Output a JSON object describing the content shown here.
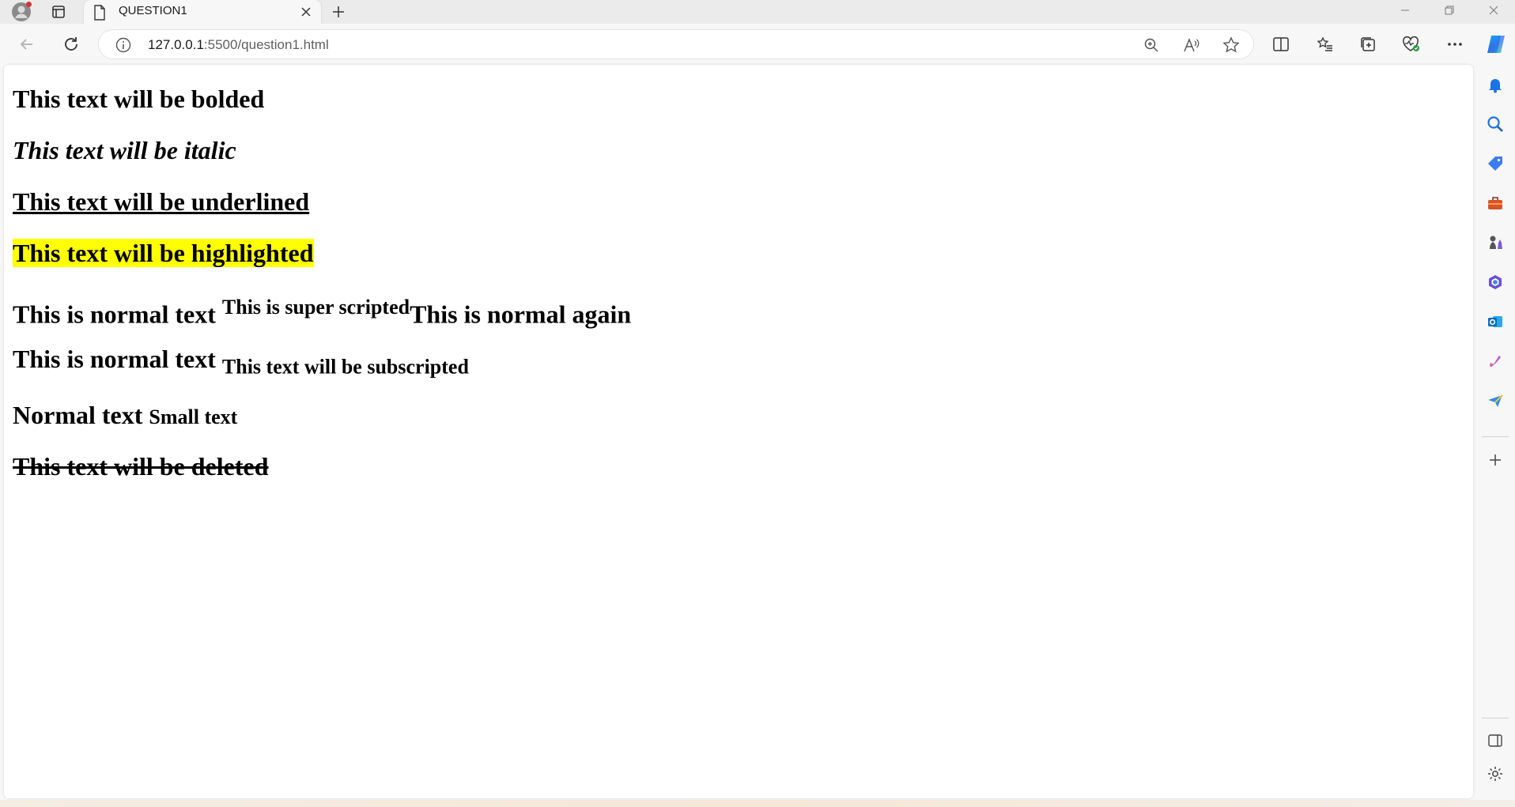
{
  "browser": {
    "tab_title": "QUESTION1",
    "url_host": "127.0.0.1",
    "url_path": ":5500/question1.html"
  },
  "page": {
    "bold_text": "This text will be bolded",
    "italic_text": "This text will be italic",
    "underline_text": "This text will be underlined",
    "highlight_text": "This text will be highlighted",
    "sup_line": {
      "normal": "This is normal text ",
      "super": "This is super scripted",
      "normal_again": "This is normal again"
    },
    "sub_line": {
      "normal": "This is normal text ",
      "sub": "This text will be subscripted"
    },
    "small_line": {
      "normal": "Normal text ",
      "small": "Small text"
    },
    "deleted_text": "This text will be deleted"
  },
  "colors": {
    "highlight": "#ffff00",
    "sidebar_accent": "#1a73e8"
  },
  "icons": {
    "sidebar": [
      "bell-icon",
      "search-icon",
      "tag-icon",
      "toolbox-icon",
      "chess-icon",
      "office-icon",
      "outlook-icon",
      "designer-icon",
      "send-icon",
      "plus-icon",
      "panel-icon",
      "settings-icon"
    ]
  }
}
